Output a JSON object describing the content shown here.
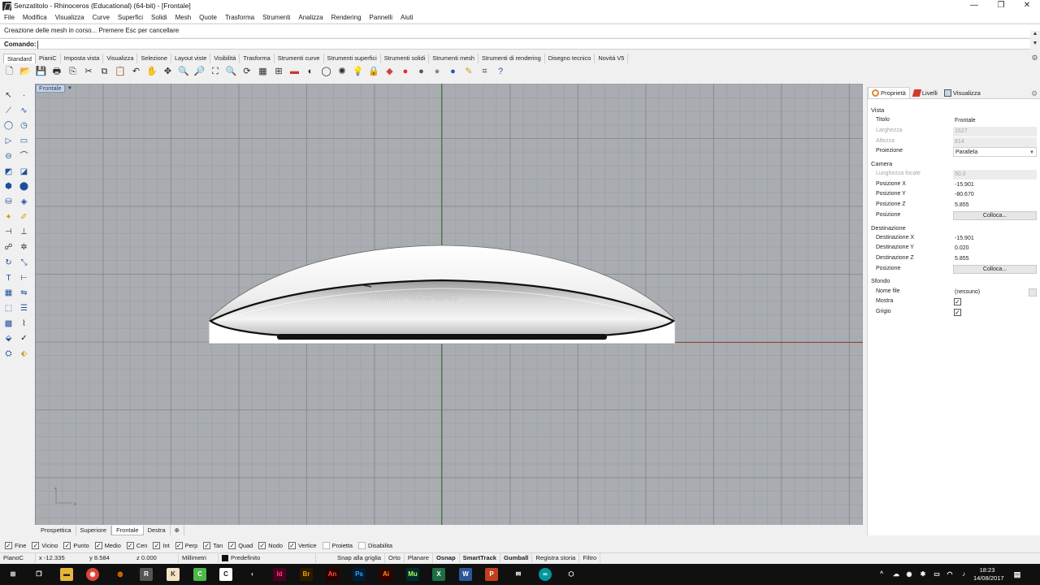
{
  "window": {
    "title": "Senzatitolo - Rhinoceros (Educational) (64-bit) - [Frontale]"
  },
  "menu": [
    "File",
    "Modifica",
    "Visualizza",
    "Curve",
    "Superfici",
    "Solidi",
    "Mesh",
    "Quote",
    "Trasforma",
    "Strumenti",
    "Analizza",
    "Rendering",
    "Pannelli",
    "Aiuti"
  ],
  "history": "Creazione delle mesh in corso... Premere Esc per cancellare",
  "command": {
    "label": "Comando:",
    "value": ""
  },
  "toolbar_tabs": [
    "Standard",
    "PianiC",
    "Imposta vista",
    "Visualizza",
    "Selezione",
    "Layout viste",
    "Visibilità",
    "Trasforma",
    "Strumenti curve",
    "Strumenti superfici",
    "Strumenti solidi",
    "Strumenti mesh",
    "Strumenti di rendering",
    "Disegno tecnico",
    "Novità V5"
  ],
  "toolbar_icons": [
    "new-file-icon",
    "open-file-icon",
    "save-icon",
    "print-icon",
    "import-icon",
    "cut-icon",
    "copy-icon",
    "paste-icon",
    "undo-icon",
    "pan-hand-icon",
    "move-view-icon",
    "zoom-in-icon",
    "zoom-window-icon",
    "zoom-extents-icon",
    "zoom-selected-icon",
    "rotate-view-icon",
    "four-views-icon",
    "set-cplane-icon",
    "hide-icon",
    "show-icon",
    "lock-icon",
    "light-icon",
    "lock-object-icon",
    "material-icon",
    "render-sphere-icon",
    "shaded-sphere-icon",
    "ghost-sphere-icon",
    "render-ball-icon",
    "dimension-icon",
    "grid-snap-icon",
    "help-icon"
  ],
  "viewport": {
    "title": "Frontale",
    "osnap_tip": "17.898 < 0° SuOrto SuPerp"
  },
  "viewport_tabs": [
    "Prospettica",
    "Superiore",
    "Frontale",
    "Destra"
  ],
  "panel": {
    "tabs": [
      "Proprietà",
      "Livelli",
      "Visualizza"
    ],
    "sections": {
      "vista": "Vista",
      "camera": "Camera",
      "destinazione": "Destinazione",
      "sfondo": "Sfondo"
    },
    "vista_rows": [
      {
        "label": "Titolo",
        "value": "Frontale"
      },
      {
        "label": "Larghezza",
        "value": "1527"
      },
      {
        "label": "Altezza",
        "value": "814"
      },
      {
        "label": "Proiezione",
        "value": "Parallela"
      }
    ],
    "camera_rows": [
      {
        "label": "Lunghezza focale",
        "value": "50.0"
      },
      {
        "label": "Posizione X",
        "value": "-15.901"
      },
      {
        "label": "Posizione Y",
        "value": "-80.670"
      },
      {
        "label": "Posizione Z",
        "value": "5.855"
      },
      {
        "label": "Posizione",
        "value": "Colloca..."
      }
    ],
    "dest_rows": [
      {
        "label": "Destinazione X",
        "value": "-15.901"
      },
      {
        "label": "Destinazione Y",
        "value": "0.020"
      },
      {
        "label": "Destinazione Z",
        "value": "5.855"
      },
      {
        "label": "Posizione",
        "value": "Colloca..."
      }
    ],
    "sfondo_rows": [
      {
        "label": "Nome file",
        "value": "(nessuno)"
      },
      {
        "label": "Mostra",
        "value": "✓"
      },
      {
        "label": "Grigio",
        "value": "✓"
      }
    ]
  },
  "osnaps": [
    {
      "label": "Fine",
      "checked": true
    },
    {
      "label": "Vicino",
      "checked": true
    },
    {
      "label": "Punto",
      "checked": true
    },
    {
      "label": "Medio",
      "checked": true
    },
    {
      "label": "Cen",
      "checked": true
    },
    {
      "label": "Int",
      "checked": true
    },
    {
      "label": "Perp",
      "checked": true
    },
    {
      "label": "Tan",
      "checked": true
    },
    {
      "label": "Quad",
      "checked": true
    },
    {
      "label": "Nodo",
      "checked": true
    },
    {
      "label": "Vertice",
      "checked": true
    },
    {
      "label": "Proietta",
      "checked": false
    },
    {
      "label": "Disabilita",
      "checked": false
    }
  ],
  "status": {
    "cplane": "PianoC",
    "x": "x -12.335",
    "y": "y 8.584",
    "z": "z 0.000",
    "units": "Millimetri",
    "layer": "Predefinito",
    "modes": [
      "Snap alla griglia",
      "Orto",
      "Planare",
      "Osnap",
      "SmartTrack",
      "Gumball",
      "Registra storia",
      "Filtro"
    ]
  },
  "clock": {
    "time": "18:23",
    "date": "14/08/2017"
  }
}
